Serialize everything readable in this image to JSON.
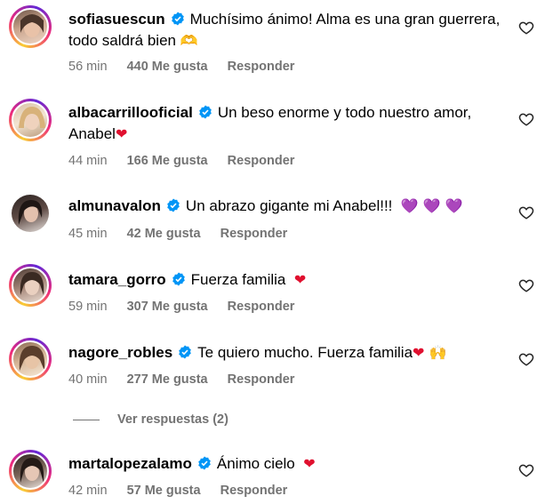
{
  "comments": [
    {
      "username": "sofiasuescun",
      "text": "Muchísimo ánimo! Alma es una gran guerrera, todo saldrá bien",
      "emoji": "🫶",
      "time": "56 min",
      "likes": "440 Me gusta",
      "reply": "Responder"
    },
    {
      "username": "albacarrillooficial",
      "text": "Un beso enorme y todo nuestro amor, Anabel",
      "emoji": "❤",
      "time": "44 min",
      "likes": "166 Me gusta",
      "reply": "Responder"
    },
    {
      "username": "almunavalon",
      "text": "Un abrazo gigante mi Anabel!!!",
      "emoji": "💜 💜 💜",
      "time": "45 min",
      "likes": "42 Me gusta",
      "reply": "Responder"
    },
    {
      "username": "tamara_gorro",
      "text": "Fuerza familia",
      "emoji": "❤",
      "time": "59 min",
      "likes": "307 Me gusta",
      "reply": "Responder"
    },
    {
      "username": "nagore_robles",
      "text": "Te quiero mucho. Fuerza familia",
      "emoji": "❤ 🙌",
      "time": "40 min",
      "likes": "277 Me gusta",
      "reply": "Responder"
    },
    {
      "username": "martalopezalamo",
      "text": "Ánimo cielo",
      "emoji": "❤",
      "time": "42 min",
      "likes": "57 Me gusta",
      "reply": "Responder"
    }
  ],
  "view_replies": "Ver respuestas (2)",
  "colors": {
    "verified": "#0095f6",
    "meta": "#737373",
    "heart_emoji": "#e0102f"
  }
}
